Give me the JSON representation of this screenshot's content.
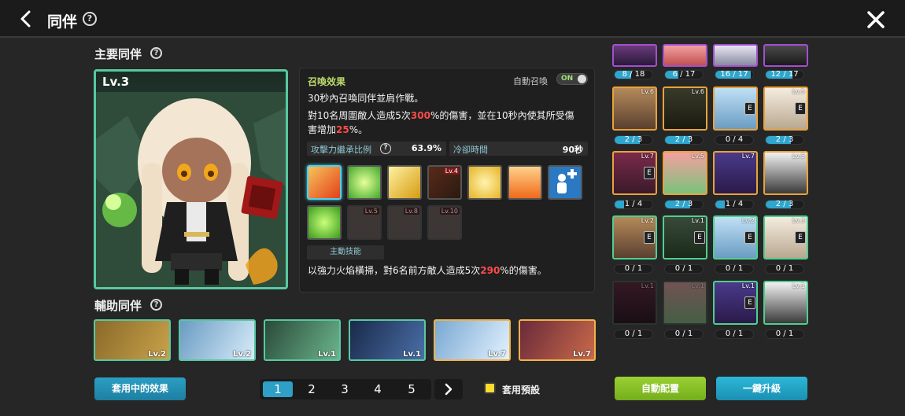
{
  "header": {
    "title": "同伴"
  },
  "main_section": {
    "label": "主要同伴",
    "level": "Lv.3"
  },
  "info": {
    "summon_title": "召喚效果",
    "auto_summon_label": "自動召喚",
    "toggle_text": "ON",
    "line1": "30秒內召喚同伴並肩作戰。",
    "line2_a": "對10名周圍敵人造成5次",
    "line2_b": "300",
    "line2_c": "%的傷害，並在10秒內使其所受傷",
    "line3_a": "害增加",
    "line3_b": "25",
    "line3_c": "%。",
    "stat1_label": "攻擊力繼承比例",
    "stat1_value": "63.9%",
    "stat2_label": "冷卻時間",
    "stat2_value": "90秒",
    "skill_levels": [
      "Lv.4",
      "Lv.5",
      "Lv.8",
      "Lv.10"
    ],
    "active_label": "主動技能",
    "active_a": "以強力火焰橫掃，對6名前方敵人造成5次",
    "active_b": "290",
    "active_c": "%的傷害。"
  },
  "support_section": {
    "label": "輔助同伴",
    "cards": [
      {
        "level": "Lv.2",
        "color": "#c9a24a"
      },
      {
        "level": "Lv.2",
        "color": "#9ec8e8"
      },
      {
        "level": "Lv.1",
        "color": "#6bb58c"
      },
      {
        "level": "Lv.1",
        "color": "#4a6fa8"
      },
      {
        "level": "Lv.7",
        "color": "#9ec8e8"
      },
      {
        "level": "Lv.7",
        "color": "#c96a4a"
      }
    ]
  },
  "grid": {
    "row0": [
      "8 / 18",
      "6 / 17",
      "16 / 17",
      "12 / 17"
    ],
    "row0_fill": [
      0.44,
      0.35,
      0.94,
      0.7
    ],
    "row1_levels": [
      "Lv.6",
      "Lv.6",
      "",
      "Lv.5"
    ],
    "row1": [
      "2 / 3",
      "2 / 3",
      "0 / 4",
      "2 / 3"
    ],
    "row1_fill": [
      0.67,
      0.67,
      0,
      0.67
    ],
    "row2_levels": [
      "Lv.7",
      "Lv.5",
      "Lv.7",
      "Lv.5"
    ],
    "row2": [
      "1 / 4",
      "2 / 3",
      "1 / 4",
      "2 / 3"
    ],
    "row2_fill": [
      0.25,
      0.67,
      0.25,
      0.67
    ],
    "row3_levels": [
      "Lv.2",
      "Lv.1",
      "Lv.2",
      "Lv.3"
    ],
    "row3": [
      "0 / 1",
      "0 / 1",
      "0 / 1",
      "0 / 1"
    ],
    "row4_levels": [
      "Lv.1",
      "Lv.1",
      "Lv.1",
      "Lv.1"
    ],
    "row4": [
      "0 / 1",
      "0 / 1",
      "0 / 1",
      "0 / 1"
    ]
  },
  "bottom": {
    "effects_button": "套用中的效果",
    "pages": [
      "1",
      "2",
      "3",
      "4",
      "5"
    ],
    "preset_label": "套用預設",
    "auto_config": "自動配置",
    "one_click_upgrade": "一鍵升級"
  }
}
